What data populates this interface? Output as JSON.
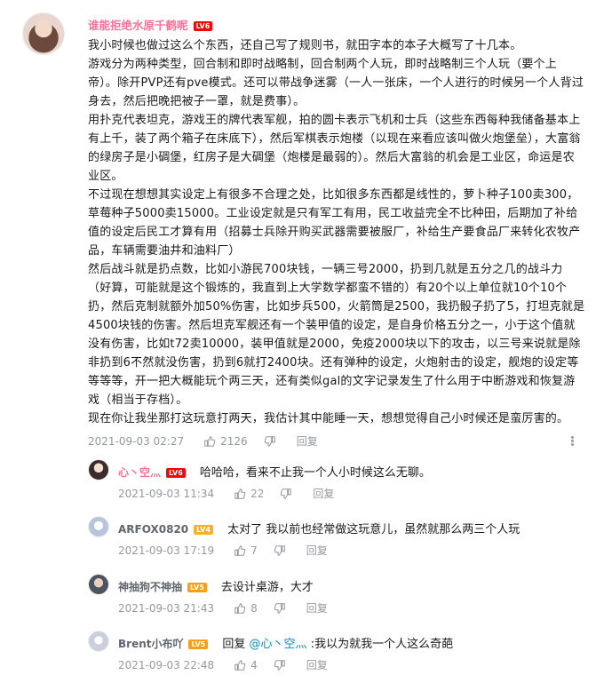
{
  "main": {
    "username": "谁能拒绝水原千鹤呢",
    "level": "LV6",
    "paragraphs": [
      "我小时候也做过这么个东西，还自己写了规则书，就田字本的本子大概写了十几本。",
      "游戏分为两种类型，回合制和即时战略制，回合制两个人玩，即时战略制三个人玩（要个上帝）。除开PVP还有pve模式。还可以带战争迷雾（一人一张床，一个人进行的时候另一个人背过身去，然后把晚把被子一罩，就是费事）。",
      "用扑克代表坦克，游戏王的牌代表军舰，拍的圆卡表示飞机和士兵（这些东西每种我储备基本上有上千，装了两个箱子在床底下），然后军棋表示炮楼（以现在来看应该叫做火炮堡垒），大富翁的绿房子是小碉堡，红房子是大碉堡（炮楼是最弱的）。然后大富翁的机会是工业区，命运是农业区。",
      "不过现在想想其实设定上有很多不合理之处，比如很多东西都是线性的，萝卜种子100卖300，草莓种子5000卖15000。工业设定就是只有军工有用，民工收益完全不比种田，后期加了补给值的设定后民工才算有用（招募士兵除开购买武器需要被服厂，补给生产要食品厂来转化农牧产品，车辆需要油井和油料厂）",
      "然后战斗就是扔点数，比如小游民700块钱，一辆三号2000，扔到几就是五分之几的战斗力（好算，可能就是这个锻炼的，我直到上大学数学都蛮不错的）有20个以上单位就10个10个扔，然后克制就额外加50%伤害，比如步兵500，火箭筒是2500，我扔骰子扔了5，打坦克就是4500块钱的伤害。然后坦克军舰还有一个装甲值的设定，是自身价格五分之一，小于这个值就没有伤害，比如t72卖10000，装甲值就是2000，免疫2000块以下的攻击，以三号来说就是除非扔到6不然就没伤害，扔到6就打2400块。还有弹种的设定，火炮射击的设定，舰炮的设定等等等等，开一把大概能玩个两三天，还有类似gal的文字记录发生了什么用于中断游戏和恢复游戏（相当于存档）。",
      "现在你让我坐那打这玩意打两天，我估计其中能睡一天，想想觉得自己小时候还是蛮厉害的。"
    ],
    "time": "2021-09-03 02:27",
    "likes": "2126",
    "reply": "回复"
  },
  "replies": [
    {
      "username": "心丶空灬",
      "level": "LV6",
      "text": "哈哈哈，看来不止我一个人小时候这么无聊。",
      "time": "2021-09-03 11:34",
      "likes": "22",
      "reply": "回复"
    },
    {
      "username": "ARFOX0820",
      "level": "LV4",
      "text": "太对了 我以前也经常做这玩意儿，虽然就那么两三个人玩",
      "time": "2021-09-03 17:19",
      "likes": "7",
      "reply": "回复"
    },
    {
      "username": "神抽狗不神抽",
      "level": "LV5",
      "text": "去设计桌游，大才",
      "time": "2021-09-03 21:43",
      "likes": "8",
      "reply": "回复"
    },
    {
      "username": "Brent小布吖",
      "level": "LV5",
      "text_prefix": "回复",
      "mention": "@心丶空灬",
      "text_suffix": ":我以为就我一个人这么奇葩",
      "time": "2021-09-03 22:48",
      "likes": "4",
      "reply": "回复"
    }
  ],
  "colors": {
    "vip_name": "#fb7299",
    "normal_name": "#61666d",
    "mention": "#008ac5",
    "meta": "#9499a0"
  },
  "icons": {
    "like": "thumbs-up-icon",
    "dislike": "thumbs-down-icon",
    "more": "more-dots-icon"
  }
}
